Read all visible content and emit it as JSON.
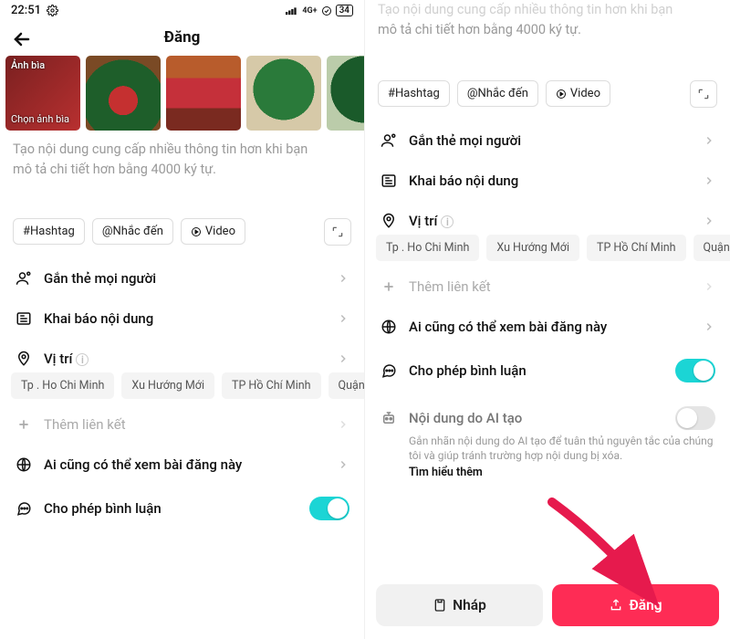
{
  "status": {
    "time": "22:51",
    "network": "4G+",
    "battery": "34"
  },
  "header": {
    "title": "Đăng"
  },
  "cover": {
    "label": "Ảnh bìa",
    "option": "Chọn ảnh bìa"
  },
  "description_hint_line1": "Tạo nội dung cung cấp nhiều thông tin hơn khi bạn",
  "description_hint_line2": "mô tả chi tiết hơn bằng 4000 ký tự.",
  "right_desc_frag_line1": "Tạo nội dung cung cấp nhiều thông tin hơn khi bạn",
  "right_desc_frag_line2": "mô tả chi tiết hơn bằng 4000 ký tự.",
  "tags": {
    "hashtag": "#Hashtag",
    "mention": "@Nhắc đến",
    "video": "Video"
  },
  "rows": {
    "tag_people": "Gắn thẻ mọi người",
    "declare": "Khai báo nội dung",
    "location": "Vị trí",
    "add_link": "Thêm liên kết",
    "visibility": "Ai cũng có thể xem bài đăng này",
    "comments": "Cho phép bình luận",
    "ai_content": "Nội dung do AI tạo"
  },
  "locations": [
    "Tp . Ho Chi Minh",
    "Xu Hướng Mới",
    "TP Hồ Chí Minh",
    "Quận"
  ],
  "ai_subtext": "Gắn nhãn nội dung do AI tạo để tuân thủ nguyên tắc của chúng tôi và giúp tránh trường hợp nội dung bị xóa.",
  "ai_learn": "Tìm hiểu thêm",
  "buttons": {
    "draft": "Nháp",
    "post": "Đăng"
  }
}
